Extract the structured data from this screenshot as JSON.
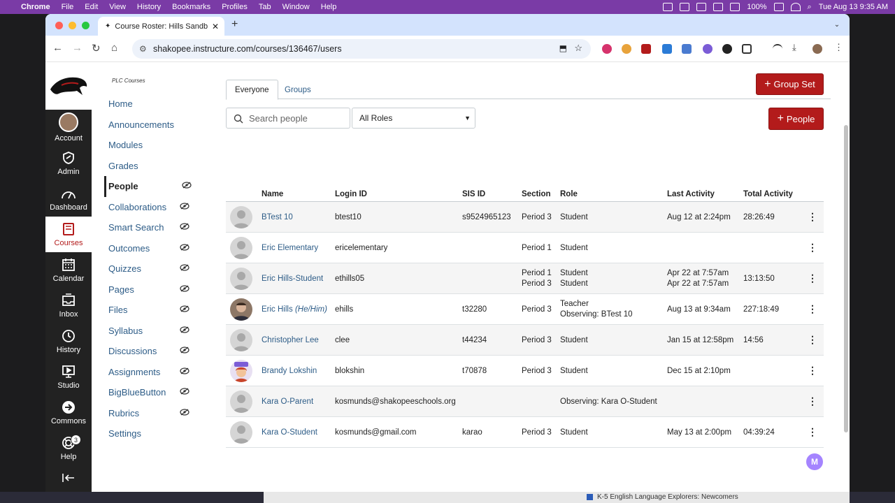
{
  "menubar": {
    "app": "Chrome",
    "items": [
      "File",
      "Edit",
      "View",
      "History",
      "Bookmarks",
      "Profiles",
      "Tab",
      "Window",
      "Help"
    ],
    "battery": "100%",
    "datetime": "Tue Aug 13  9:35 AM"
  },
  "browser": {
    "tab_title": "Course Roster: Hills Sandbox",
    "url": "shakopee.instructure.com/courses/136467/users"
  },
  "global_nav": {
    "items": [
      {
        "label": "Account"
      },
      {
        "label": "Admin"
      },
      {
        "label": "Dashboard"
      },
      {
        "label": "Courses"
      },
      {
        "label": "Calendar"
      },
      {
        "label": "Inbox"
      },
      {
        "label": "History"
      },
      {
        "label": "Studio"
      },
      {
        "label": "Commons"
      },
      {
        "label": "Help",
        "badge": "3"
      }
    ]
  },
  "course_nav": {
    "title": "PLC Courses",
    "items": [
      {
        "label": "Home"
      },
      {
        "label": "Announcements"
      },
      {
        "label": "Modules"
      },
      {
        "label": "Grades"
      },
      {
        "label": "People"
      },
      {
        "label": "Collaborations"
      },
      {
        "label": "Smart Search"
      },
      {
        "label": "Outcomes"
      },
      {
        "label": "Quizzes"
      },
      {
        "label": "Pages"
      },
      {
        "label": "Files"
      },
      {
        "label": "Syllabus"
      },
      {
        "label": "Discussions"
      },
      {
        "label": "Assignments"
      },
      {
        "label": "BigBlueButton"
      },
      {
        "label": "Rubrics"
      },
      {
        "label": "Settings"
      }
    ]
  },
  "people": {
    "tabs": [
      "Everyone",
      "Groups"
    ],
    "group_set_button": "Group Set",
    "people_button": "People",
    "search_placeholder": "Search people",
    "role_filter": "All Roles",
    "columns": [
      "Name",
      "Login ID",
      "SIS ID",
      "Section",
      "Role",
      "Last Activity",
      "Total Activity"
    ],
    "rows": [
      {
        "name": "BTest 10",
        "pronoun": "",
        "login": "btest10",
        "sis": "s9524965123",
        "section": [
          "Period 3"
        ],
        "role": [
          "Student"
        ],
        "last": [
          "Aug 12 at 2:24pm"
        ],
        "total": "28:26:49"
      },
      {
        "name": "Eric Elementary",
        "pronoun": "",
        "login": "ericelementary",
        "sis": "",
        "section": [
          "Period 1"
        ],
        "role": [
          "Student"
        ],
        "last": [
          ""
        ],
        "total": ""
      },
      {
        "name": "Eric Hills-Student",
        "pronoun": "",
        "login": "ethills05",
        "sis": "",
        "section": [
          "Period 1",
          "Period 3"
        ],
        "role": [
          "Student",
          "Student"
        ],
        "last": [
          "Apr 22 at 7:57am",
          "Apr 22 at 7:57am"
        ],
        "total": "13:13:50"
      },
      {
        "name": "Eric Hills",
        "pronoun": "(He/Him)",
        "login": "ehills",
        "sis": "t32280",
        "section": [
          "Period 3"
        ],
        "role": [
          "Teacher",
          "Observing: BTest 10"
        ],
        "last": [
          "Aug 13 at 9:34am"
        ],
        "total": "227:18:49"
      },
      {
        "name": "Christopher Lee",
        "pronoun": "",
        "login": "clee",
        "sis": "t44234",
        "section": [
          "Period 3"
        ],
        "role": [
          "Student"
        ],
        "last": [
          "Jan 15 at 12:58pm"
        ],
        "total": "14:56"
      },
      {
        "name": "Brandy Lokshin",
        "pronoun": "",
        "login": "blokshin",
        "sis": "t70878",
        "section": [
          "Period 3"
        ],
        "role": [
          "Student"
        ],
        "last": [
          "Dec 15 at 2:10pm"
        ],
        "total": ""
      },
      {
        "name": "Kara O-Parent",
        "pronoun": "",
        "login": "kosmunds@shakopeeschools.org",
        "sis": "",
        "section": [
          ""
        ],
        "role": [
          "Observing: Kara O-Student"
        ],
        "last": [
          ""
        ],
        "total": ""
      },
      {
        "name": "Kara O-Student",
        "pronoun": "",
        "login": "kosmunds@gmail.com",
        "sis": "karao",
        "section": [
          "Period 3"
        ],
        "role": [
          "Student"
        ],
        "last": [
          "May 13 at 2:00pm"
        ],
        "total": "04:39:24"
      }
    ]
  },
  "desktop_strip": "K-5 English Language Explorers: Newcomers",
  "colors": {
    "brand_red": "#b31b1b",
    "link": "#2d5c87",
    "nav_bg": "#222222"
  }
}
